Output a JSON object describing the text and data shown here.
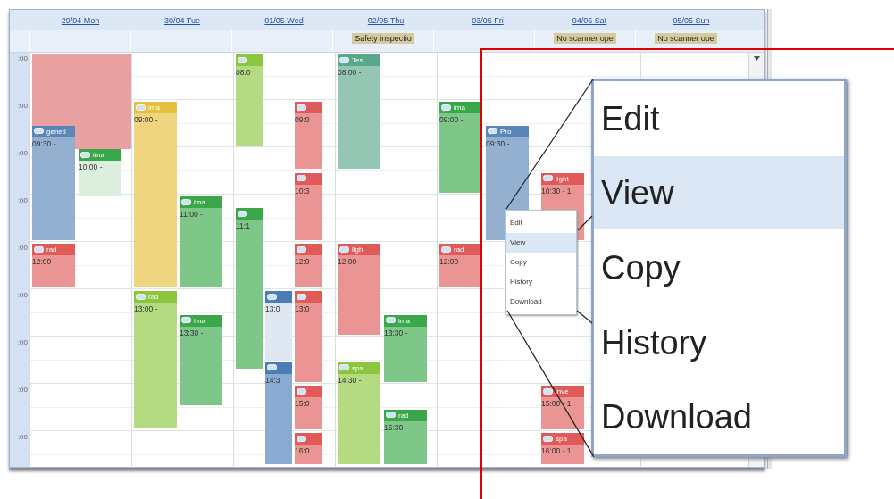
{
  "calendar": {
    "hours": [
      ":00",
      ":00",
      ":00",
      ":00",
      ":00",
      ":00",
      ":00",
      ":00",
      ":00"
    ],
    "days": [
      {
        "label": "29/04 Mon",
        "events": [
          {
            "kind": "block",
            "color": "#e8a0a0"
          },
          {
            "kind": "appointment",
            "title": "geneti",
            "time": "09:30 -",
            "color": "#5a86b8"
          },
          {
            "kind": "appointment",
            "title": "ima",
            "time": "10:00 -",
            "color": "#3aa84a"
          },
          {
            "kind": "appointment",
            "title": "rad",
            "time": "12:00 -",
            "color": "#e05a5a"
          }
        ]
      },
      {
        "label": "30/04 Tue",
        "events": [
          {
            "kind": "appointment",
            "title": "ima",
            "time": "09:00 -",
            "color": "#e6bf3c"
          },
          {
            "kind": "appointment",
            "title": "ima",
            "time": "11:00 -",
            "color": "#3aa84a"
          },
          {
            "kind": "appointment",
            "title": "rad",
            "time": "13:00 -",
            "color": "#8cc63f"
          },
          {
            "kind": "appointment",
            "title": "ima",
            "time": "13:30 -",
            "color": "#3aa84a"
          }
        ]
      },
      {
        "label": "01/05 Wed",
        "events": [
          {
            "kind": "appointment",
            "time": "08:0",
            "color": "#8cc63f"
          },
          {
            "kind": "appointment",
            "time": "11:1",
            "color": "#3aa84a"
          },
          {
            "kind": "appointment",
            "time": "13:0",
            "color": "#4a7cb8"
          },
          {
            "kind": "appointment",
            "time": "14:3",
            "color": "#4a7cb8"
          },
          {
            "kind": "appointment",
            "time": "09:0",
            "color": "#e05a5a"
          },
          {
            "kind": "appointment",
            "time": "10:3",
            "color": "#e05a5a"
          },
          {
            "kind": "appointment",
            "time": "12:0",
            "color": "#e05a5a"
          },
          {
            "kind": "appointment",
            "time": "13:0",
            "color": "#e05a5a"
          },
          {
            "kind": "appointment",
            "time": "15:0",
            "color": "#e05a5a"
          },
          {
            "kind": "appointment",
            "time": "16:0",
            "color": "#e05a5a"
          }
        ]
      },
      {
        "label": "02/05 Thu",
        "all_day": "Safety inspectio",
        "events": [
          {
            "kind": "appointment",
            "title": "Tes",
            "time": "08:00 -",
            "color": "#5aa88a"
          },
          {
            "kind": "appointment",
            "title": "ligh",
            "time": "12:00 -",
            "color": "#e05a5a"
          },
          {
            "kind": "appointment",
            "title": "spa",
            "time": "14:30 -",
            "color": "#8cc63f"
          },
          {
            "kind": "appointment",
            "title": "ima",
            "time": "13:30 -",
            "color": "#3aa84a"
          },
          {
            "kind": "appointment",
            "title": "rad",
            "time": "15:30 -",
            "color": "#3aa84a"
          }
        ]
      },
      {
        "label": "03/05 Fri",
        "events": [
          {
            "kind": "appointment",
            "title": "ima",
            "time": "09:00 -",
            "color": "#3aa84a"
          },
          {
            "kind": "appointment",
            "title": "Pro",
            "time": "09:30 -",
            "color": "#5a86b8"
          },
          {
            "kind": "appointment",
            "title": "rad",
            "time": "12:00 -",
            "color": "#e05a5a"
          }
        ]
      },
      {
        "label": "04/05 Sat",
        "all_day": "No scanner ope",
        "events": [
          {
            "kind": "appointment",
            "title": "light",
            "time": "10:30 - 1",
            "color": "#e05a5a"
          },
          {
            "kind": "appointment",
            "title": "inve",
            "time": "15:00 - 1",
            "color": "#e05a5a"
          },
          {
            "kind": "appointment",
            "title": "spa",
            "time": "16:00 - 1",
            "color": "#e05a5a"
          }
        ]
      },
      {
        "label": "05/05 Sun",
        "all_day": "No scanner ope"
      }
    ]
  },
  "context_menu": {
    "items": [
      {
        "label": "Edit",
        "selected": false
      },
      {
        "label": "View",
        "selected": true
      },
      {
        "label": "Copy",
        "selected": false
      },
      {
        "label": "History",
        "selected": false
      },
      {
        "label": "Download",
        "selected": false
      }
    ]
  },
  "magnified_menu": {
    "items": [
      {
        "label": "Edit",
        "selected": false
      },
      {
        "label": "View",
        "selected": true
      },
      {
        "label": "Copy",
        "selected": false
      },
      {
        "label": "History",
        "selected": false
      },
      {
        "label": "Download",
        "selected": false
      }
    ]
  }
}
